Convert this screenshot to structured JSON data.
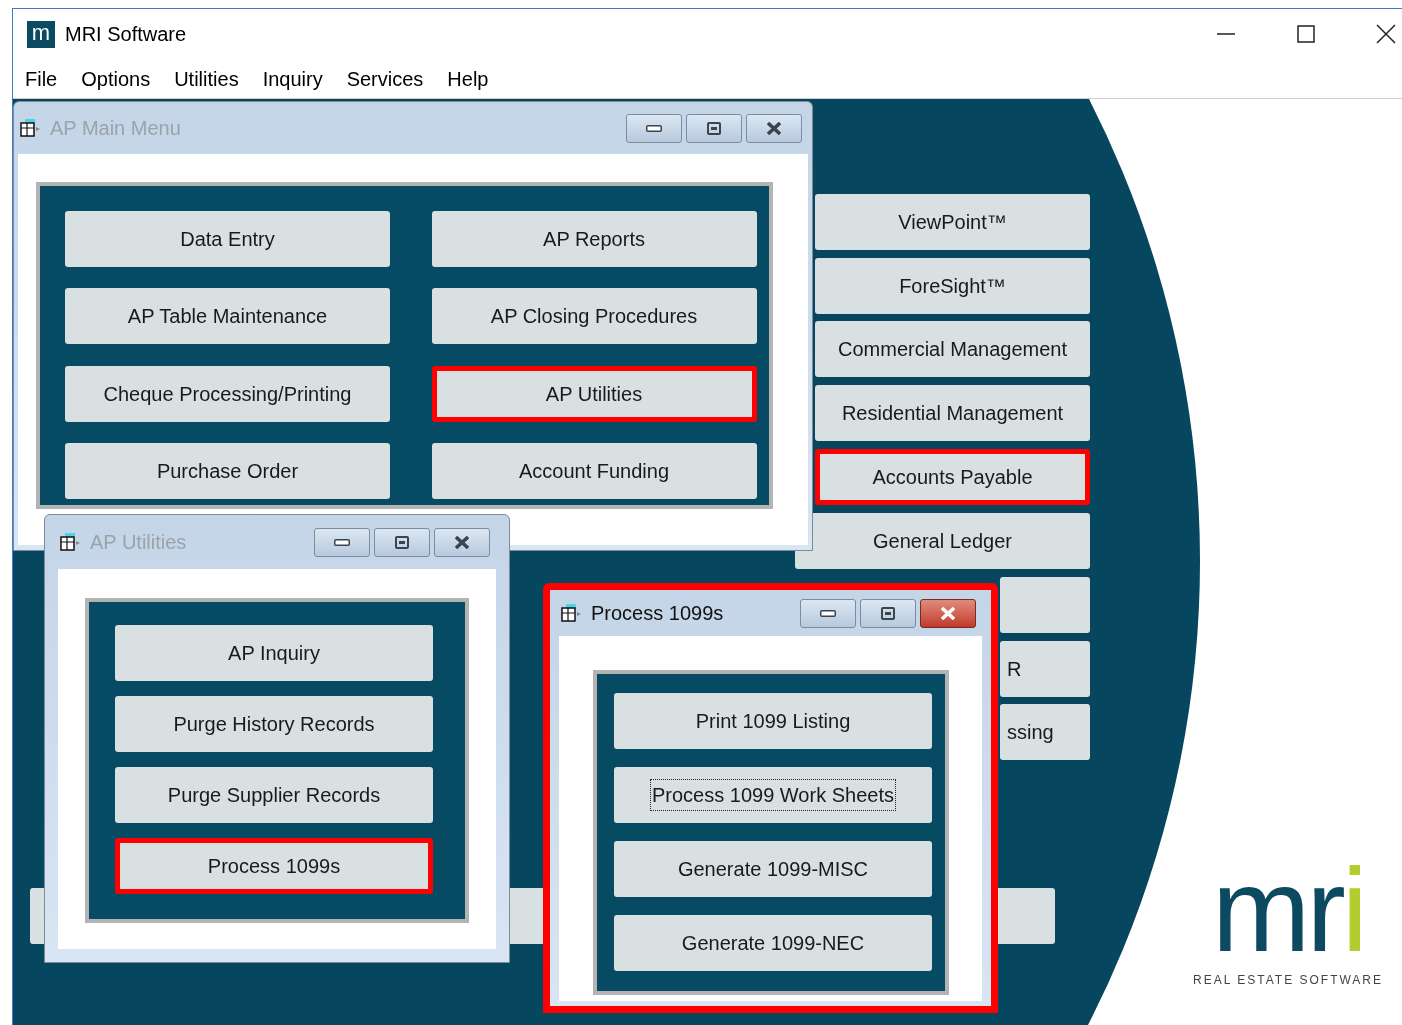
{
  "app": {
    "logo_text": "m",
    "title": "MRI Software"
  },
  "menu": [
    {
      "label": "File"
    },
    {
      "label": "Options"
    },
    {
      "label": "Utilities"
    },
    {
      "label": "Inquiry"
    },
    {
      "label": "Services"
    },
    {
      "label": "Help"
    }
  ],
  "background_buttons": [
    {
      "kind": "full",
      "label": "ViewPoint™",
      "highlighted": false
    },
    {
      "kind": "full",
      "label": "ForeSight™",
      "highlighted": false
    },
    {
      "kind": "full",
      "label": "Commercial Management",
      "highlighted": false
    },
    {
      "kind": "full",
      "label": "Residential Management",
      "highlighted": false
    },
    {
      "kind": "full",
      "label": "Accounts Payable",
      "highlighted": true
    },
    {
      "kind": "full",
      "label": "General Ledger",
      "highlighted": false
    },
    {
      "kind": "clipped",
      "highlighted": false
    },
    {
      "kind": "clipped",
      "label": "R",
      "highlighted": false
    },
    {
      "kind": "clipped",
      "label": "ssing",
      "highlighted": false
    },
    {
      "kind": "wide",
      "highlighted": false
    }
  ],
  "windows": [
    {
      "title": "AP Main Menu",
      "active": false,
      "highlighted": false,
      "buttons": [
        {
          "label": "Data Entry",
          "highlighted": false,
          "focused": false
        },
        {
          "label": "AP Reports",
          "highlighted": false,
          "focused": false
        },
        {
          "label": "AP Table Maintenance",
          "highlighted": false,
          "focused": false
        },
        {
          "label": "AP Closing Procedures",
          "highlighted": false,
          "focused": false
        },
        {
          "label": "Cheque Processing/Printing",
          "highlighted": false,
          "focused": false
        },
        {
          "label": "AP Utilities",
          "highlighted": true,
          "focused": false
        },
        {
          "label": "Purchase Order",
          "highlighted": false,
          "focused": false
        },
        {
          "label": "Account Funding",
          "highlighted": false,
          "focused": false
        }
      ]
    },
    {
      "title": "AP Utilities",
      "active": false,
      "highlighted": false,
      "buttons": [
        {
          "label": "AP Inquiry",
          "highlighted": false,
          "focused": false
        },
        {
          "label": "Purge History Records",
          "highlighted": false,
          "focused": false
        },
        {
          "label": "Purge Supplier Records",
          "highlighted": false,
          "focused": false
        },
        {
          "label": "Process 1099s",
          "highlighted": true,
          "focused": false
        }
      ]
    },
    {
      "title": "Process 1099s",
      "active": true,
      "highlighted": true,
      "buttons": [
        {
          "label": "Print 1099 Listing",
          "highlighted": false,
          "focused": false
        },
        {
          "label": "Process 1099 Work Sheets",
          "highlighted": false,
          "focused": true
        },
        {
          "label": "Generate 1099-MISC",
          "highlighted": false,
          "focused": false
        },
        {
          "label": "Generate 1099-NEC",
          "highlighted": false,
          "focused": false
        }
      ]
    }
  ],
  "logo": {
    "parts": [
      {
        "text": "mr",
        "color": "#0b4a60"
      },
      {
        "text": "i",
        "color": "#b5cc2e"
      }
    ],
    "tagline": "REAL ESTATE SOFTWARE"
  }
}
